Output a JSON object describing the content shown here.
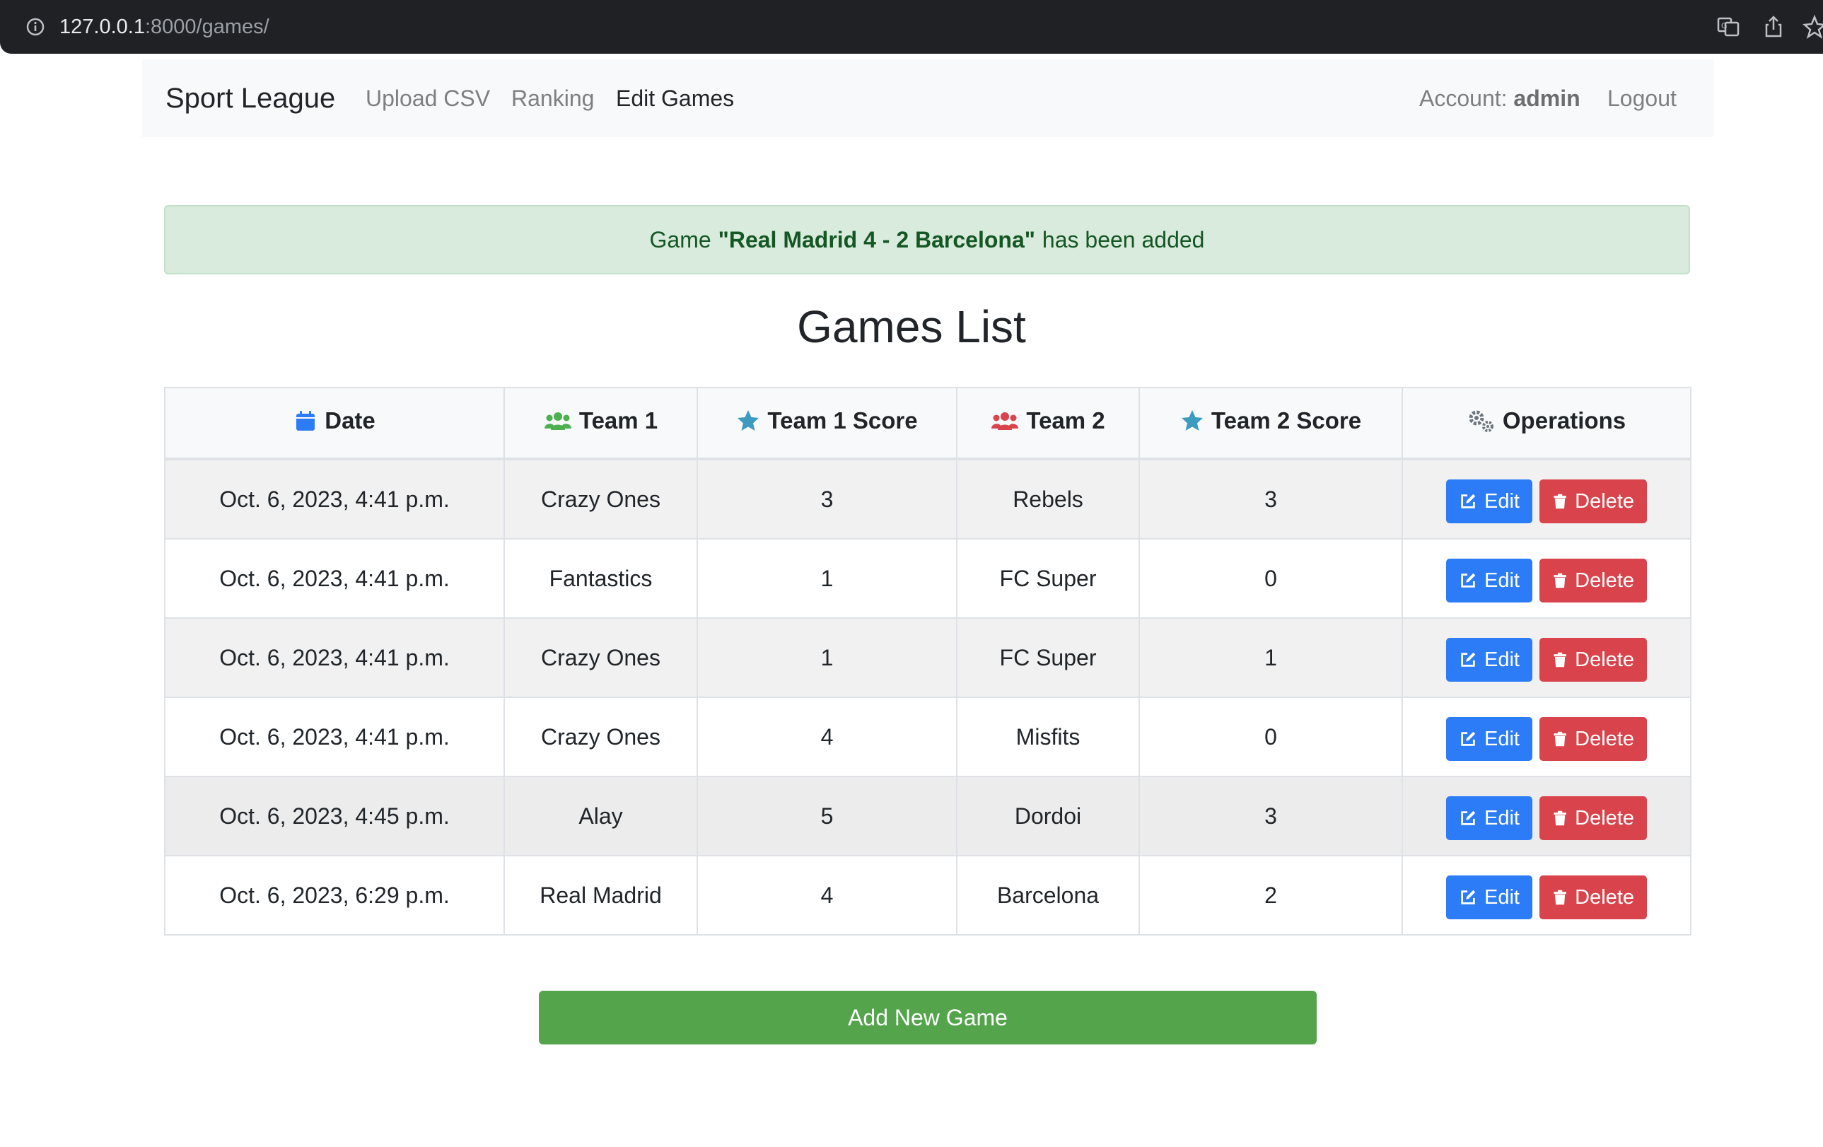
{
  "browser": {
    "url_host": "127.0.0.1",
    "url_rest": ":8000/games/"
  },
  "navbar": {
    "brand": "Sport League",
    "links": [
      {
        "label": "Upload CSV"
      },
      {
        "label": "Ranking"
      },
      {
        "label": "Edit Games"
      }
    ],
    "account_label": "Account:",
    "account_user": "admin",
    "logout_label": "Logout"
  },
  "alert": {
    "prefix": "Game",
    "game": "\"Real Madrid 4 - 2 Barcelona\"",
    "suffix": "has been added"
  },
  "page_title": "Games List",
  "table": {
    "headers": {
      "date": "Date",
      "team1": "Team 1",
      "team1_score": "Team 1 Score",
      "team2": "Team 2",
      "team2_score": "Team 2 Score",
      "operations": "Operations"
    },
    "edit_label": "Edit",
    "delete_label": "Delete",
    "rows": [
      {
        "date": "Oct. 6, 2023, 4:41 p.m.",
        "team1": "Crazy Ones",
        "score1": "3",
        "team2": "Rebels",
        "score2": "3"
      },
      {
        "date": "Oct. 6, 2023, 4:41 p.m.",
        "team1": "Fantastics",
        "score1": "1",
        "team2": "FC Super",
        "score2": "0"
      },
      {
        "date": "Oct. 6, 2023, 4:41 p.m.",
        "team1": "Crazy Ones",
        "score1": "1",
        "team2": "FC Super",
        "score2": "1"
      },
      {
        "date": "Oct. 6, 2023, 4:41 p.m.",
        "team1": "Crazy Ones",
        "score1": "4",
        "team2": "Misfits",
        "score2": "0"
      },
      {
        "date": "Oct. 6, 2023, 4:45 p.m.",
        "team1": "Alay",
        "score1": "5",
        "team2": "Dordoi",
        "score2": "3"
      },
      {
        "date": "Oct. 6, 2023, 6:29 p.m.",
        "team1": "Real Madrid",
        "score1": "4",
        "team2": "Barcelona",
        "score2": "2"
      }
    ]
  },
  "add_button": "Add New Game",
  "colors": {
    "edit": "#2b7cf6",
    "delete": "#d9444c",
    "add": "#54a44b",
    "alert_bg": "#d9ebdd",
    "alert_text": "#155724"
  }
}
